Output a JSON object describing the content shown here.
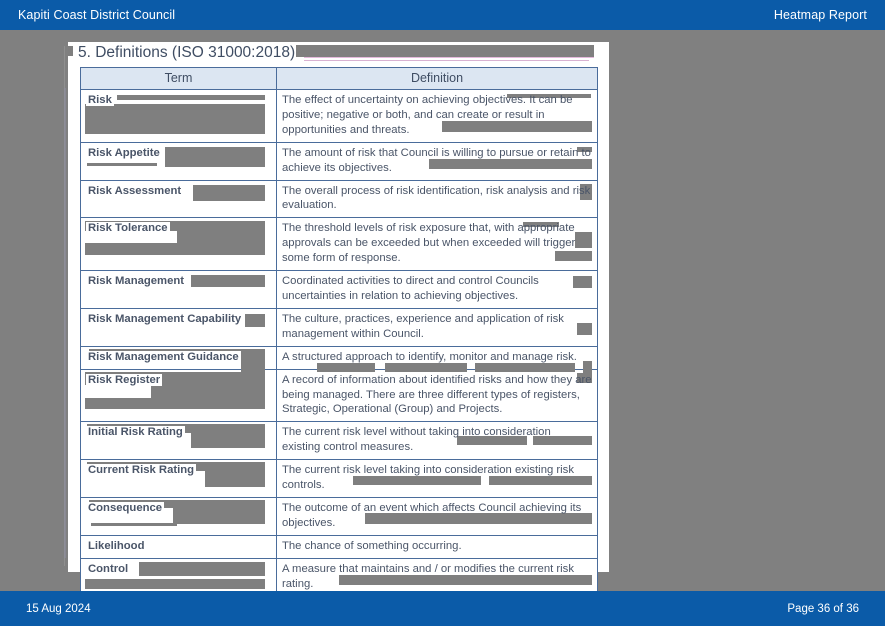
{
  "header": {
    "org_name": "Kapiti Coast District Council",
    "report_name": "Heatmap Report"
  },
  "footer": {
    "date": "15 Aug 2024",
    "page_label": "Page 36 of 36"
  },
  "document": {
    "section_title": "5.  Definitions (ISO 31000:2018)",
    "table": {
      "columns": [
        "Term",
        "Definition"
      ],
      "rows": [
        {
          "term": "Risk",
          "definition": "The effect of uncertainty on achieving objectives. It can be positive; negative or both, and can create or result in opportunities and threats."
        },
        {
          "term": "Risk Appetite",
          "definition": "The amount of risk that Council is willing to pursue or retain to achieve its objectives."
        },
        {
          "term": "Risk Assessment",
          "definition": "The overall process of risk identification, risk analysis and risk evaluation."
        },
        {
          "term": "Risk Tolerance",
          "definition": "The threshold levels of risk exposure that, with appropriate approvals can be exceeded but when exceeded will trigger some form of response."
        },
        {
          "term": "Risk Management",
          "definition": "Coordinated activities to direct and control Councils uncertainties in relation to achieving objectives."
        },
        {
          "term": "Risk Management Capability",
          "definition": "The culture, practices, experience and application of risk management within Council."
        },
        {
          "term": "Risk Management Guidance",
          "definition": "A structured approach to identify, monitor and manage risk."
        },
        {
          "term": "Risk Register",
          "definition": "A record of information about identified risks and how they are being managed. There are three different types of registers, Strategic, Operational (Group) and Projects."
        },
        {
          "term": "Initial Risk Rating",
          "definition": "The current risk level without taking into consideration existing control measures."
        },
        {
          "term": "Current Risk Rating",
          "definition": "The current risk level taking into consideration existing risk controls."
        },
        {
          "term": "Consequence",
          "definition": "The outcome of an event which affects Council achieving its objectives."
        },
        {
          "term": "Likelihood",
          "definition": "The chance of something occurring."
        },
        {
          "term": "Control",
          "definition": "A measure that maintains and / or modifies the current risk rating."
        }
      ]
    }
  },
  "colors": {
    "brand_blue": "#0b5ba8",
    "page_background": "#808080",
    "table_border": "#4a6c9b",
    "table_header_fill": "#dce6f2",
    "body_text": "#4a5568"
  }
}
